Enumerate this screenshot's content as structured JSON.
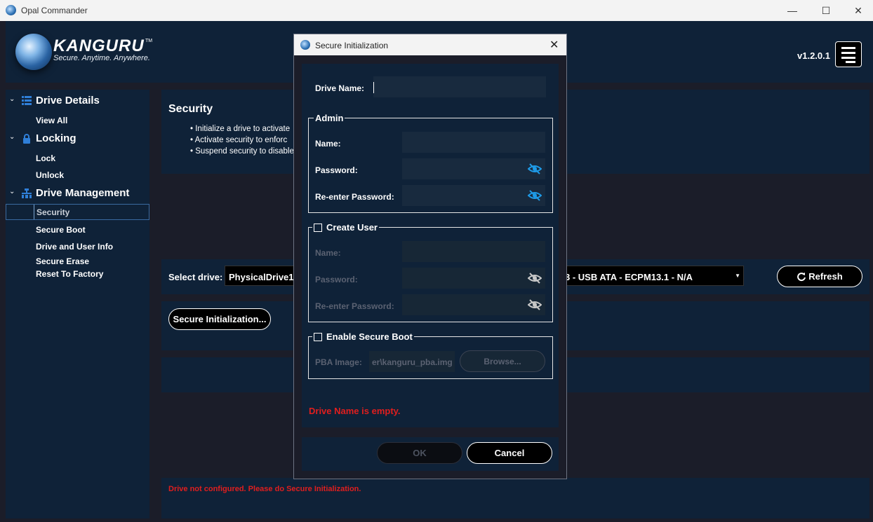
{
  "window": {
    "title": "Opal Commander",
    "minimize": "—",
    "maximize": "☐",
    "close": "✕"
  },
  "header": {
    "logo_text": "KANGURU",
    "logo_tm": "TM",
    "tagline": "Secure. Anytime. Anywhere.",
    "version": "v1.2.0.1"
  },
  "sidebar": {
    "groups": [
      {
        "label": "Drive Details",
        "icon": "list-icon",
        "items": [
          "View All"
        ]
      },
      {
        "label": "Locking",
        "icon": "lock-icon",
        "items": [
          "Lock",
          "Unlock"
        ]
      },
      {
        "label": "Drive Management",
        "icon": "drive-management-icon",
        "items": [
          "Security",
          "Secure Boot",
          "Drive and User Info",
          "Secure Erase",
          "Reset To Factory"
        ]
      }
    ],
    "selected": "Security"
  },
  "main": {
    "security_title": "Security",
    "bullets": [
      "Initialize a drive to activate",
      "Activate security to enforc",
      "Suspend security to disable"
    ],
    "select_drive_label": "Select drive:",
    "drive_value_left": "PhysicalDrive1",
    "drive_value_right": "3 - USB ATA - ECPM13.1 - N/A",
    "refresh_label": "Refresh",
    "secure_init_label": "Secure Initialization...",
    "status_message": "Drive not configured. Please do Secure Initialization."
  },
  "dialog": {
    "title": "Secure Initialization",
    "close": "✕",
    "drive_name_label": "Drive Name:",
    "drive_name_value": "",
    "admin": {
      "legend": "Admin",
      "name_label": "Name:",
      "password_label": "Password:",
      "reenter_label": "Re-enter Password:"
    },
    "create_user": {
      "legend": "Create User",
      "checked": false,
      "name_label": "Name:",
      "password_label": "Password:",
      "reenter_label": "Re-enter Password:"
    },
    "secure_boot": {
      "legend": "Enable Secure Boot",
      "checked": false,
      "pba_label": "PBA Image:",
      "pba_value": "er\\kanguru_pba.img",
      "browse_label": "Browse..."
    },
    "error": "Drive Name is empty.",
    "ok_label": "OK",
    "cancel_label": "Cancel",
    "colors": {
      "error": "#e01e1e",
      "panel": "#0f2238",
      "eye_active": "#1e9be8",
      "eye_disabled": "#c8c8c8"
    }
  }
}
